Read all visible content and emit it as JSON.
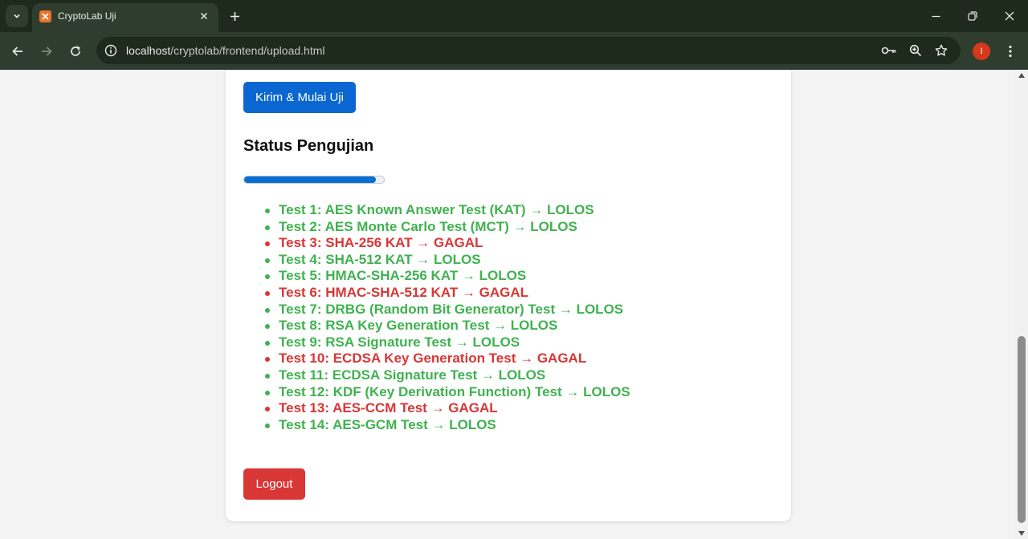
{
  "browser": {
    "tab_title": "CryptoLab Uji",
    "url_host": "localhost",
    "url_path": "/cryptolab/frontend/upload.html",
    "profile_initial": "I"
  },
  "page": {
    "submit_label": "Kirim & Mulai Uji",
    "status_heading": "Status Pengujian",
    "progress_percent": 94,
    "results": [
      {
        "text": "Test 1: AES Known Answer Test (KAT) → LOLOS",
        "status": "pass"
      },
      {
        "text": "Test 2: AES Monte Carlo Test (MCT) → LOLOS",
        "status": "pass"
      },
      {
        "text": "Test 3: SHA-256 KAT → GAGAL",
        "status": "fail"
      },
      {
        "text": "Test 4: SHA-512 KAT → LOLOS",
        "status": "pass"
      },
      {
        "text": "Test 5: HMAC-SHA-256 KAT → LOLOS",
        "status": "pass"
      },
      {
        "text": "Test 6: HMAC-SHA-512 KAT → GAGAL",
        "status": "fail"
      },
      {
        "text": "Test 7: DRBG (Random Bit Generator) Test → LOLOS",
        "status": "pass"
      },
      {
        "text": "Test 8: RSA Key Generation Test → LOLOS",
        "status": "pass"
      },
      {
        "text": "Test 9: RSA Signature Test → LOLOS",
        "status": "pass"
      },
      {
        "text": "Test 10: ECDSA Key Generation Test → GAGAL",
        "status": "fail"
      },
      {
        "text": "Test 11: ECDSA Signature Test → LOLOS",
        "status": "pass"
      },
      {
        "text": "Test 12: KDF (Key Derivation Function) Test → LOLOS",
        "status": "pass"
      },
      {
        "text": "Test 13: AES-CCM Test → GAGAL",
        "status": "fail"
      },
      {
        "text": "Test 14: AES-GCM Test → LOLOS",
        "status": "pass"
      }
    ],
    "logout_label": "Logout"
  },
  "colors": {
    "primary": "#0a66d0",
    "pass": "#3fb24f",
    "fail": "#d93636",
    "logout": "#d93636"
  }
}
